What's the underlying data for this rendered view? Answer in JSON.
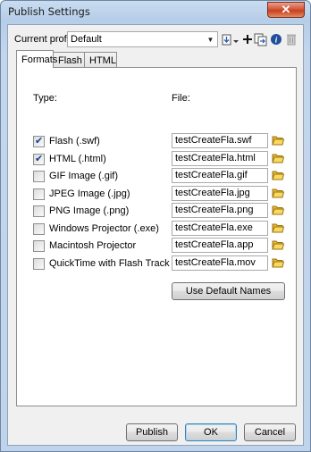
{
  "window": {
    "title": "Publish Settings",
    "close_symbol": "✕"
  },
  "profile": {
    "label": "Current profile:",
    "value": "Default"
  },
  "tabs": [
    {
      "label": "Formats",
      "active": true
    },
    {
      "label": "Flash",
      "active": false
    },
    {
      "label": "HTML",
      "active": false
    }
  ],
  "columns": {
    "type": "Type:",
    "file": "File:"
  },
  "formats": [
    {
      "label": "Flash  (.swf)",
      "checked": true,
      "file": "testCreateFla.swf"
    },
    {
      "label": "HTML  (.html)",
      "checked": true,
      "file": "testCreateFla.html"
    },
    {
      "label": "GIF Image  (.gif)",
      "checked": false,
      "file": "testCreateFla.gif"
    },
    {
      "label": "JPEG Image  (.jpg)",
      "checked": false,
      "file": "testCreateFla.jpg"
    },
    {
      "label": "PNG Image  (.png)",
      "checked": false,
      "file": "testCreateFla.png"
    },
    {
      "label": "Windows Projector  (.exe)",
      "checked": false,
      "file": "testCreateFla.exe"
    },
    {
      "label": "Macintosh Projector",
      "checked": false,
      "file": "testCreateFla.app"
    },
    {
      "label": "QuickTime with Flash Track  (.mov)",
      "checked": false,
      "file": "testCreateFla.mov"
    }
  ],
  "use_default_names_label": "Use Default Names",
  "footer": {
    "publish_label": "Publish",
    "ok_label": "OK",
    "cancel_label": "Cancel"
  },
  "icons": {
    "import_export": "import-export-icon",
    "add": "plus-icon",
    "duplicate": "duplicate-profile-icon",
    "settings": "profile-settings-icon",
    "delete": "trash-icon",
    "folder": "folder-icon"
  }
}
